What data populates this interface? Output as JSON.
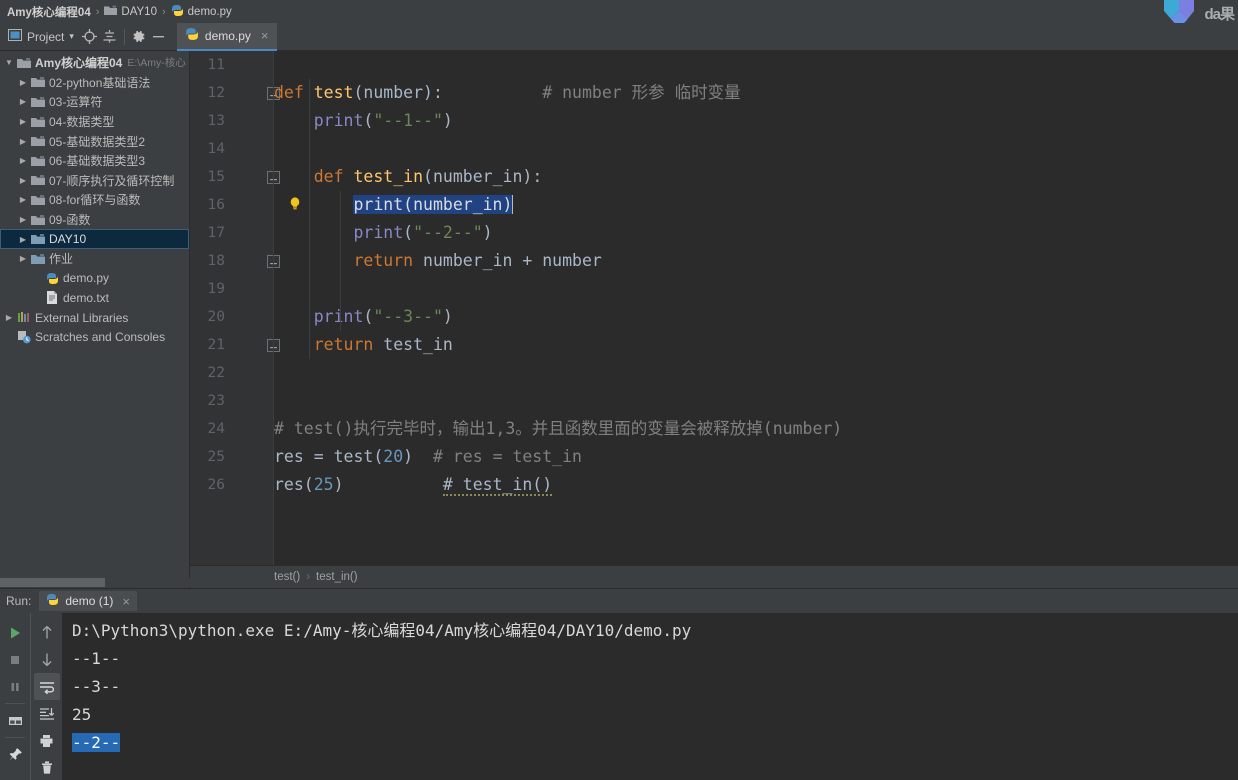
{
  "titlebar": {
    "crumbs": [
      {
        "label": "Amy核心编程04",
        "icon": "none",
        "bold": true
      },
      {
        "label": "DAY10",
        "icon": "folder-icon",
        "bold": false
      },
      {
        "label": "demo.py",
        "icon": "python-file-icon",
        "bold": false
      }
    ],
    "separator": "›"
  },
  "toolbar": {
    "project_label": "Project",
    "dropdown_caret": "▾",
    "icons": [
      "project-panel-icon",
      "locate-icon",
      "collapse-all-icon",
      "settings-gear-icon",
      "hide-icon"
    ],
    "editor_tab": {
      "label": "demo.py",
      "icon": "python-file-icon",
      "close": "×"
    }
  },
  "sidebar": {
    "items": [
      {
        "label": "Amy核心编程04",
        "path": "E:\\Amy-核心",
        "icon": "folder-icon",
        "arrow": "▼",
        "depth": 0,
        "bold": true,
        "selected": false
      },
      {
        "label": "02-python基础语法",
        "path": "",
        "icon": "folder-icon",
        "arrow": "▶",
        "depth": 1,
        "bold": false,
        "selected": false
      },
      {
        "label": "03-运算符",
        "path": "",
        "icon": "folder-icon",
        "arrow": "▶",
        "depth": 1,
        "bold": false,
        "selected": false
      },
      {
        "label": "04-数据类型",
        "path": "",
        "icon": "folder-icon",
        "arrow": "▶",
        "depth": 1,
        "bold": false,
        "selected": false
      },
      {
        "label": "05-基础数据类型2",
        "path": "",
        "icon": "folder-icon",
        "arrow": "▶",
        "depth": 1,
        "bold": false,
        "selected": false
      },
      {
        "label": "06-基础数据类型3",
        "path": "",
        "icon": "folder-icon",
        "arrow": "▶",
        "depth": 1,
        "bold": false,
        "selected": false
      },
      {
        "label": "07-顺序执行及循环控制",
        "path": "",
        "icon": "folder-icon",
        "arrow": "▶",
        "depth": 1,
        "bold": false,
        "selected": false
      },
      {
        "label": "08-for循环与函数",
        "path": "",
        "icon": "folder-icon",
        "arrow": "▶",
        "depth": 1,
        "bold": false,
        "selected": false
      },
      {
        "label": "09-函数",
        "path": "",
        "icon": "folder-icon",
        "arrow": "▶",
        "depth": 1,
        "bold": false,
        "selected": false
      },
      {
        "label": "DAY10",
        "path": "",
        "icon": "folder-open-icon",
        "arrow": "▶",
        "depth": 1,
        "bold": false,
        "selected": true
      },
      {
        "label": "作业",
        "path": "",
        "icon": "folder-open-icon",
        "arrow": "▶",
        "depth": 1,
        "bold": false,
        "selected": false
      },
      {
        "label": "demo.py",
        "path": "",
        "icon": "python-file-icon",
        "arrow": "",
        "depth": 2,
        "bold": false,
        "selected": false
      },
      {
        "label": "demo.txt",
        "path": "",
        "icon": "text-file-icon",
        "arrow": "",
        "depth": 2,
        "bold": false,
        "selected": false
      },
      {
        "label": "External Libraries",
        "path": "",
        "icon": "libraries-icon",
        "arrow": "▶",
        "depth": 0,
        "bold": false,
        "selected": false
      },
      {
        "label": "Scratches and Consoles",
        "path": "",
        "icon": "scratches-icon",
        "arrow": "",
        "depth": 0,
        "bold": false,
        "selected": false
      }
    ]
  },
  "editor": {
    "first_line_number": 11,
    "lines": [
      {
        "num": 11,
        "fold": false,
        "bulb": false,
        "tokens": []
      },
      {
        "num": 12,
        "fold": true,
        "bulb": false,
        "tokens": [
          {
            "t": "kw",
            "v": "def"
          },
          {
            "t": "def",
            "v": " "
          },
          {
            "t": "fn",
            "v": "test"
          },
          {
            "t": "def",
            "v": "(number):"
          },
          {
            "t": "def",
            "v": "          "
          },
          {
            "t": "cmt",
            "v": "# number 形参 临时变量"
          }
        ]
      },
      {
        "num": 13,
        "fold": false,
        "bulb": false,
        "tokens": [
          {
            "t": "def",
            "v": "    "
          },
          {
            "t": "pf",
            "v": "print"
          },
          {
            "t": "def",
            "v": "("
          },
          {
            "t": "str",
            "v": "\"--1--\""
          },
          {
            "t": "def",
            "v": ")"
          }
        ]
      },
      {
        "num": 14,
        "fold": false,
        "bulb": false,
        "tokens": []
      },
      {
        "num": 15,
        "fold": true,
        "bulb": false,
        "tokens": [
          {
            "t": "def",
            "v": "    "
          },
          {
            "t": "kw",
            "v": "def"
          },
          {
            "t": "def",
            "v": " "
          },
          {
            "t": "fn",
            "v": "test_in"
          },
          {
            "t": "def",
            "v": "(number_in):"
          }
        ]
      },
      {
        "num": 16,
        "fold": false,
        "bulb": true,
        "tokens": [
          {
            "t": "def",
            "v": "        "
          },
          {
            "t": "sel",
            "v": "print(number_in)"
          },
          {
            "t": "caret",
            "v": ""
          }
        ]
      },
      {
        "num": 17,
        "fold": false,
        "bulb": false,
        "tokens": [
          {
            "t": "def",
            "v": "        "
          },
          {
            "t": "pf",
            "v": "print"
          },
          {
            "t": "def",
            "v": "("
          },
          {
            "t": "str",
            "v": "\"--2--\""
          },
          {
            "t": "def",
            "v": ")"
          }
        ]
      },
      {
        "num": 18,
        "fold": true,
        "bulb": false,
        "tokens": [
          {
            "t": "def",
            "v": "        "
          },
          {
            "t": "kw",
            "v": "return"
          },
          {
            "t": "def",
            "v": " number_in + number"
          }
        ]
      },
      {
        "num": 19,
        "fold": false,
        "bulb": false,
        "tokens": []
      },
      {
        "num": 20,
        "fold": false,
        "bulb": false,
        "tokens": [
          {
            "t": "def",
            "v": "    "
          },
          {
            "t": "pf",
            "v": "print"
          },
          {
            "t": "def",
            "v": "("
          },
          {
            "t": "str",
            "v": "\"--3--\""
          },
          {
            "t": "def",
            "v": ")"
          }
        ]
      },
      {
        "num": 21,
        "fold": true,
        "bulb": false,
        "tokens": [
          {
            "t": "def",
            "v": "    "
          },
          {
            "t": "kw",
            "v": "return"
          },
          {
            "t": "def",
            "v": " test_in"
          }
        ]
      },
      {
        "num": 22,
        "fold": false,
        "bulb": false,
        "tokens": []
      },
      {
        "num": 23,
        "fold": false,
        "bulb": false,
        "tokens": []
      },
      {
        "num": 24,
        "fold": false,
        "bulb": false,
        "tokens": [
          {
            "t": "cmt",
            "v": "# test()执行完毕时，输出1,3。并且函数里面的变量会被释放掉(number)"
          }
        ]
      },
      {
        "num": 25,
        "fold": false,
        "bulb": false,
        "tokens": [
          {
            "t": "def",
            "v": "res = "
          },
          {
            "t": "def",
            "v": "test("
          },
          {
            "t": "num",
            "v": "20"
          },
          {
            "t": "def",
            "v": ")  "
          },
          {
            "t": "cmt",
            "v": "# res = test_in"
          }
        ]
      },
      {
        "num": 26,
        "fold": false,
        "bulb": false,
        "tokens": [
          {
            "t": "def",
            "v": "res("
          },
          {
            "t": "num",
            "v": "25"
          },
          {
            "t": "def",
            "v": ")          "
          },
          {
            "t": "squig",
            "v": "# test_in()"
          }
        ]
      }
    ],
    "breadcrumb": {
      "items": [
        "test()",
        "test_in()"
      ],
      "separator": "›"
    }
  },
  "run_panel": {
    "label": "Run:",
    "tab": {
      "label": "demo (1)",
      "icon": "python-icon",
      "close": "×"
    },
    "left_icons": [
      "run-icon",
      "stop-icon",
      "pause-icon",
      "layout-icon",
      "pin-icon"
    ],
    "right_icons": [
      "arrow-up-icon",
      "arrow-down-icon",
      "soft-wrap-icon",
      "scroll-to-end-icon",
      "print-icon",
      "trash-icon"
    ],
    "console_lines": [
      {
        "text": "D:\\Python3\\python.exe E:/Amy-核心编程04/Amy核心编程04/DAY10/demo.py",
        "highlight": false
      },
      {
        "text": "--1--",
        "highlight": false
      },
      {
        "text": "--3--",
        "highlight": false
      },
      {
        "text": "25",
        "highlight": false
      },
      {
        "text": "--2--",
        "highlight": true
      }
    ]
  },
  "watermark": {
    "text": "da果",
    "icon": "logo-icon"
  },
  "colors": {
    "bg_panel": "#3c3f41",
    "bg_editor": "#2b2b2b",
    "gutter": "#313335",
    "accent_blue": "#4a88c7",
    "selection": "#214283",
    "tree_selected": "#0d293e",
    "keyword": "#cc7832",
    "function": "#ffc66d",
    "string": "#6a8759",
    "number": "#6897bb",
    "comment": "#808080",
    "console_highlight": "#2669b5"
  }
}
